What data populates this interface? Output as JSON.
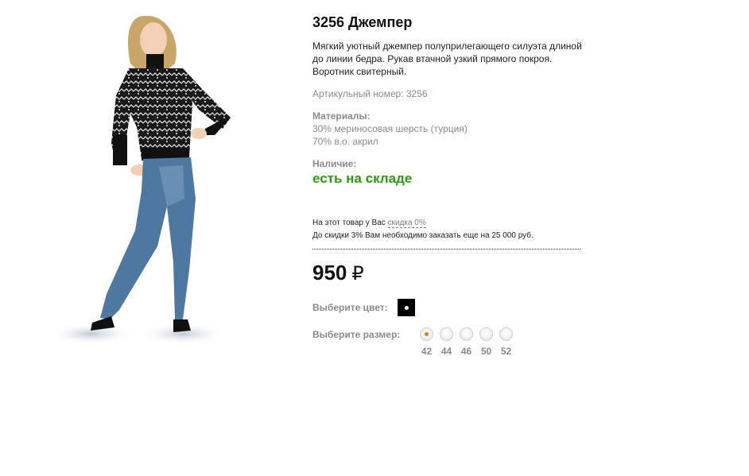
{
  "product": {
    "title": "3256 Джемпер",
    "description": "Мягкий уютный джемпер полуприлегающего силуэта длиной до линии бедра. Рукав втачной узкий прямого покроя. Воротник свитерный.",
    "article": "Артикульный номер: 3256",
    "materials_label": "Материалы:",
    "materials": [
      "30% мериносовая шерсть (турция)",
      "70% в.о. акрил"
    ],
    "availability_label": "Наличие:",
    "availability_value": "есть на складе"
  },
  "discount": {
    "line1_prefix": "На этот товар у Вас",
    "line1_link": "скидка 0%",
    "line2": "До скидки 3% Вам необходимо заказать еще на 25 000 руб."
  },
  "price": {
    "value": "950",
    "currency": "₽"
  },
  "color": {
    "label": "Выберите цвет:",
    "selected": "#000000"
  },
  "size": {
    "label": "Выберите размер:",
    "options": [
      "42",
      "44",
      "46",
      "50",
      "52"
    ],
    "selected": "42"
  },
  "colors": {
    "in_stock": "#2f9a12",
    "link": "#8a7a6a",
    "muted": "#8a8a8a"
  }
}
